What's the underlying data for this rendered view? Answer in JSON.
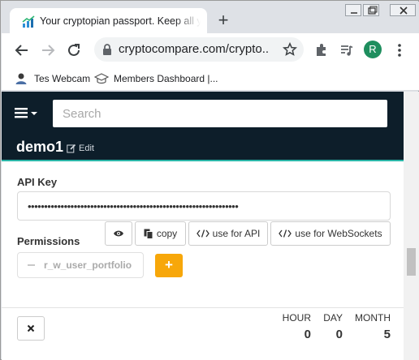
{
  "browser": {
    "tab_title": "Your cryptopian passport. Keep all y",
    "new_tab": "+",
    "url": "cryptocompare.com/crypto...",
    "profile_initial": "R",
    "bookmarks": [
      {
        "label": "Tes Webcam",
        "icon": "person-icon"
      },
      {
        "label": "Members Dashboard |...",
        "icon": "graduation-cap-icon"
      }
    ]
  },
  "page": {
    "search_placeholder": "Search",
    "username": "demo1",
    "edit_label": "Edit",
    "api_key_label": "API Key",
    "api_key_value": "••••••••••••••••••••••••••••••••••••••••••••••••••••••••••••••••",
    "key_buttons": {
      "copy": "copy",
      "use_for_api": "use for API",
      "use_for_websockets": "use for WebSockets"
    },
    "permissions_label": "Permissions",
    "permission": "r_w_user_portfolio",
    "add_label": "+",
    "stats": [
      {
        "label": "HOUR",
        "value": "0"
      },
      {
        "label": "DAY",
        "value": "0"
      },
      {
        "label": "MONTH",
        "value": "5"
      }
    ]
  },
  "colors": {
    "navbar": "#0d1e2a",
    "accent_line": "#2bb6a8",
    "add_button": "#f7a70a"
  }
}
